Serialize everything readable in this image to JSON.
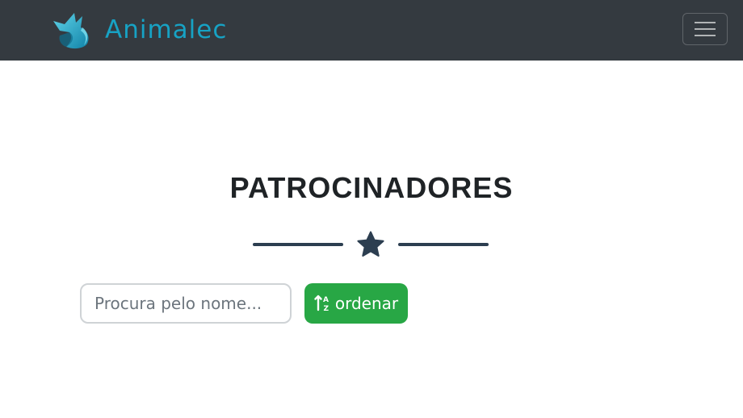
{
  "navbar": {
    "brand_name": "Animalec",
    "brand_color": "#17a2c4",
    "background": "#343a40",
    "logo_icon": "fox-logo-icon",
    "menu_icon": "hamburger-icon"
  },
  "main": {
    "title": "PATROCINADORES",
    "divider_icon": "star-icon",
    "search": {
      "placeholder": "Procura pelo nome...",
      "value": ""
    },
    "sort_button": {
      "label": "ordenar",
      "icon": "sort-alpha-icon",
      "color": "#28a745"
    }
  }
}
